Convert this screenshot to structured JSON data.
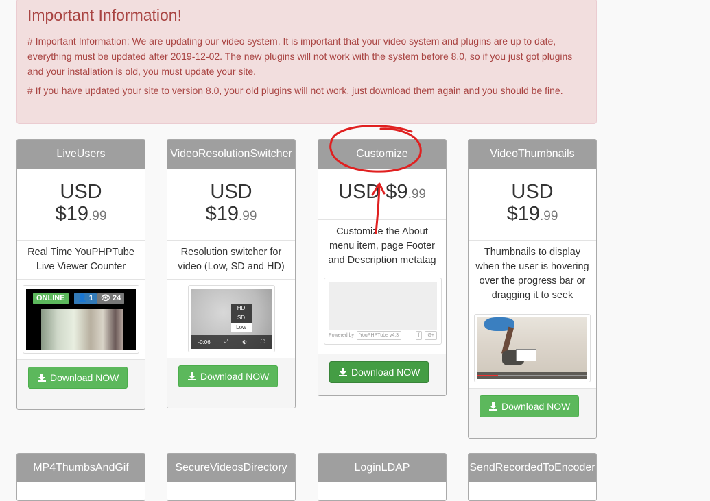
{
  "alert": {
    "title": "Important Information!",
    "p1": "# Important Information: We are updating our video system. It is important that your video system and plugins are up to date, everything must be updated after 2019-12-02. The new plugins will not work with the system before 8.0, so if you just got plugins and your installation is old, you must update your site.",
    "p2": "# If you have updated your site to version 8.0, your old plugins will not work, just download them again and you should be fine."
  },
  "plugins": [
    {
      "name": "LiveUsers",
      "currency": "USD",
      "price_main": "$19",
      "price_cents": ".99",
      "description": "Real Time YouPHPTube Live Viewer Counter",
      "download_label": "Download NOW",
      "thumb": {
        "online": "ONLINE",
        "users": "1",
        "views": "24"
      }
    },
    {
      "name": "VideoResolutionSwitcher",
      "currency": "USD",
      "price_main": "$19",
      "price_cents": ".99",
      "description": "Resolution switcher for video (Low, SD and HD)",
      "download_label": "Download NOW",
      "thumb": {
        "options": [
          "HD",
          "SD",
          "Low"
        ],
        "selected": "Low",
        "time": "-0:06"
      }
    },
    {
      "name": "Customize",
      "currency": "USD",
      "price_main": "$9",
      "price_cents": ".99",
      "description": "Customize the About menu item, page Footer and Description metatag",
      "download_label": "Download NOW",
      "thumb": {
        "powered": "Powered by",
        "brand": "YouPHPTube v4.3",
        "fb": "f",
        "gplus": "G+"
      }
    },
    {
      "name": "VideoThumbnails",
      "currency": "USD",
      "price_main": "$19",
      "price_cents": ".99",
      "description": "Thumbnails to display when the user is hovering over the progress bar or dragging it to seek",
      "download_label": "Download NOW"
    }
  ],
  "row2": [
    "MP4ThumbsAndGif",
    "SecureVideosDirectory",
    "LoginLDAP",
    "SendRecordedToEncoder"
  ],
  "colors": {
    "accent": "#5cb85c",
    "alert_bg": "#f2dede",
    "alert_text": "#a94442",
    "annotation": "#e02020",
    "header": "#9f9f9f"
  }
}
